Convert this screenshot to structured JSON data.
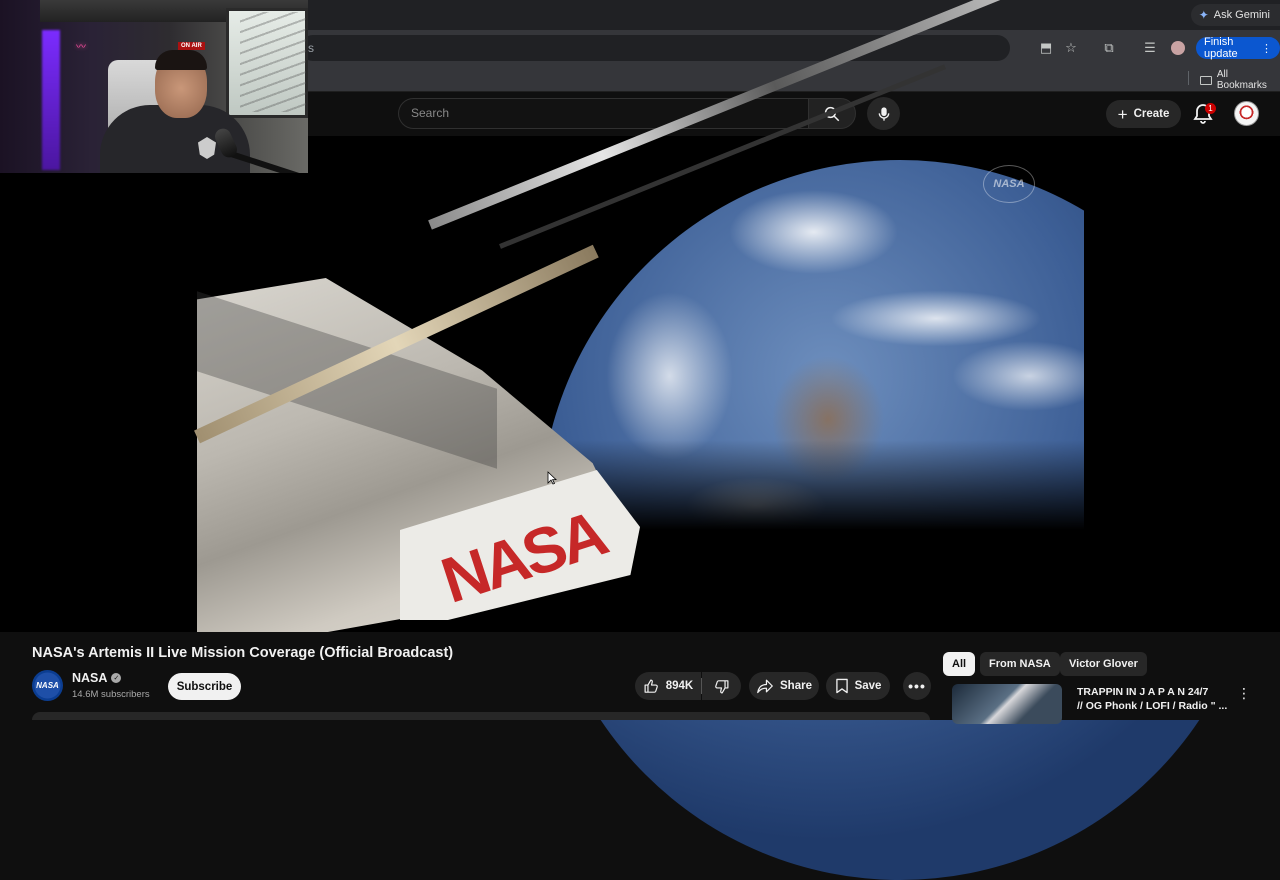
{
  "browser": {
    "gemini_label": "Ask Gemini",
    "omnibox_text": "s",
    "finish_update_label": "Finish update",
    "bookmarks_label": "All Bookmarks"
  },
  "header": {
    "search_placeholder": "Search",
    "create_label": "Create",
    "notification_count": "1"
  },
  "player": {
    "watermark": "NASA",
    "capsule_logo": "NASA"
  },
  "webcam": {
    "onair": "ON AIR"
  },
  "video": {
    "title": "NASA's Artemis II Live Mission Coverage (Official Broadcast)",
    "channel_name": "NASA",
    "channel_avatar_text": "NASA",
    "subscribers": "14.6M subscribers",
    "subscribe_label": "Subscribe",
    "likes": "894K",
    "share_label": "Share",
    "save_label": "Save"
  },
  "sidebar": {
    "chips": [
      {
        "label": "All",
        "active": true
      },
      {
        "label": "From NASA",
        "active": false
      },
      {
        "label": "Victor Glover",
        "active": false
      }
    ],
    "recommendation": {
      "title_line1": "TRAPPIN IN  J A P A N  24/7",
      "title_line2": "// OG Phonk / LOFI / Radio \" ..."
    }
  },
  "colors": {
    "background": "#0f0f0f",
    "accent_blue": "#0b57d0",
    "nasa_red": "#c62828",
    "badge_red": "#cc0000"
  }
}
